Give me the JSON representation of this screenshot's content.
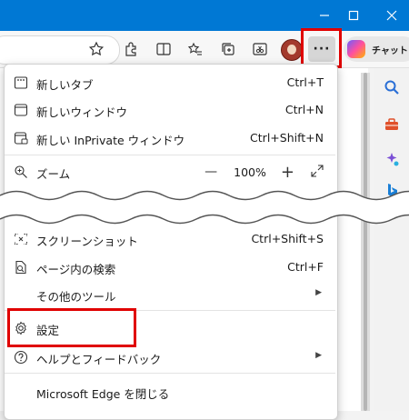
{
  "titlebar": {
    "color": "#0078d4",
    "minimize_icon": "minimize-icon",
    "maximize_icon": "maximize-icon",
    "close_icon": "close-icon"
  },
  "toolbar": {
    "chat_label": "チャット",
    "more_label": "···"
  },
  "menu": {
    "new_tab": {
      "label": "新しいタブ",
      "shortcut": "Ctrl+T"
    },
    "new_window": {
      "label": "新しいウィンドウ",
      "shortcut": "Ctrl+N"
    },
    "new_private": {
      "label": "新しい InPrivate ウィンドウ",
      "shortcut": "Ctrl+Shift+N"
    },
    "zoom": {
      "label": "ズーム",
      "minus": "—",
      "value": "100%",
      "plus": "+"
    },
    "screenshot": {
      "label": "スクリーンショット",
      "shortcut": "Ctrl+Shift+S"
    },
    "find": {
      "label": "ページ内の検索",
      "shortcut": "Ctrl+F"
    },
    "more_tools": {
      "label": "その他のツール"
    },
    "settings": {
      "label": "設定"
    },
    "help": {
      "label": "ヘルプとフィードバック"
    },
    "close_edge": {
      "label": "Microsoft Edge を閉じる"
    }
  },
  "highlight_color": "#e00000"
}
